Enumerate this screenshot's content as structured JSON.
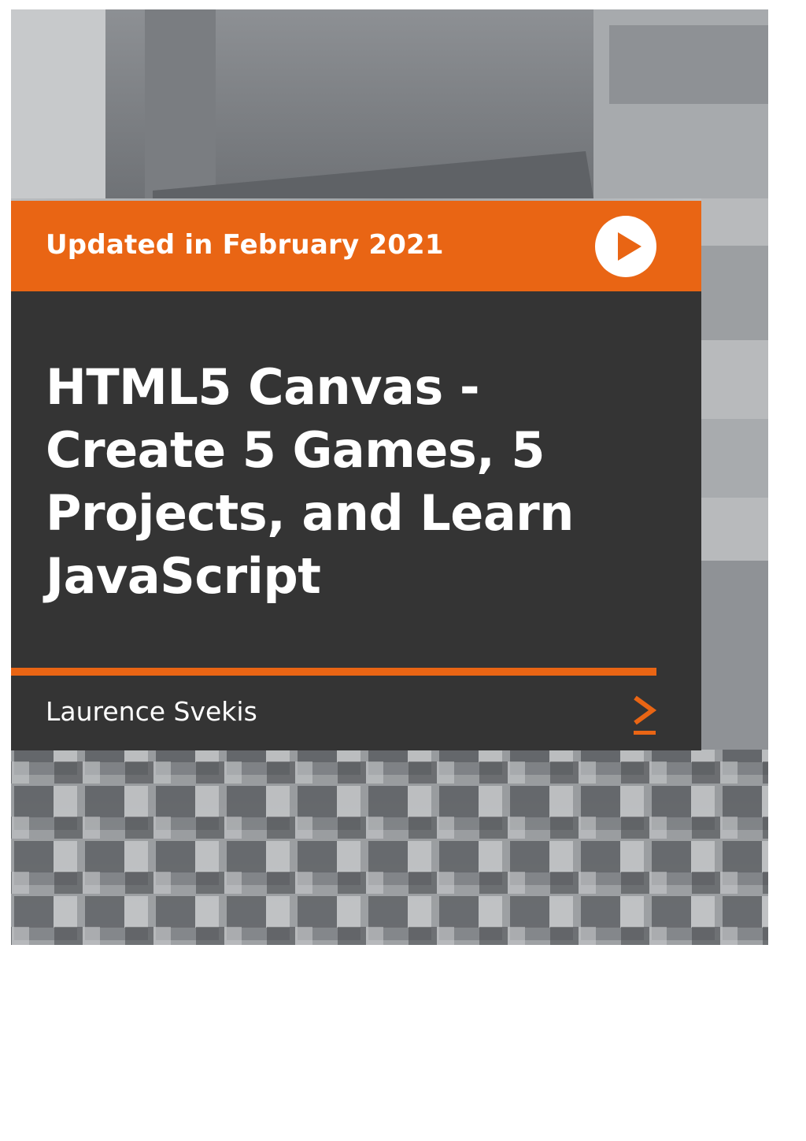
{
  "cover": {
    "banner_text": "Updated in February 2021",
    "title_lines": [
      "HTML5 Canvas -",
      "Create 5 Games, 5",
      "Projects, and Learn",
      "JavaScript"
    ],
    "author": "Laurence Svekis"
  },
  "colors": {
    "accent_orange": "#e96514",
    "panel_dark": "#343434",
    "text_white": "#ffffff"
  },
  "icons": {
    "banner": "play-icon",
    "footer": "chevron-right-icon"
  }
}
